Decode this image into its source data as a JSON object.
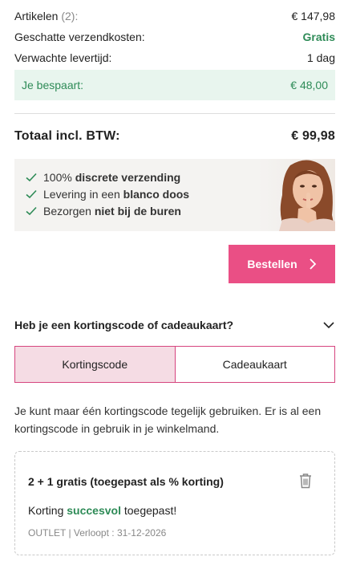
{
  "summary": {
    "items_label": "Artikelen",
    "items_count": "(2):",
    "items_value": "€ 147,98",
    "shipping_label": "Geschatte verzendkosten:",
    "shipping_value": "Gratis",
    "delivery_label": "Verwachte levertijd:",
    "delivery_value": "1 dag",
    "savings_label": "Je bespaart:",
    "savings_value": "€ 48,00",
    "total_label": "Totaal incl. BTW:",
    "total_value": "€ 99,98"
  },
  "promo": {
    "lines": [
      {
        "pre": "100%",
        "bold": "discrete verzending",
        "post": ""
      },
      {
        "pre": "Levering in een",
        "bold": "blanco doos",
        "post": ""
      },
      {
        "pre": "Bezorgen",
        "bold": "niet bij de buren",
        "post": ""
      }
    ]
  },
  "order_button": {
    "label": "Bestellen"
  },
  "coupon": {
    "heading": "Heb je een kortingscode of cadeaukaart?",
    "tabs": [
      "Kortingscode",
      "Cadeaukaart"
    ],
    "info": "Je kunt maar één kortingscode tegelijk gebruiken. Er is al een kortingscode in gebruik in je winkelmand.",
    "applied": {
      "title": "2 + 1 gratis (toegepast als % korting)",
      "status_pre": "Korting",
      "status_word": "succesvol",
      "status_post": "toegepast!",
      "meta": "OUTLET | Verloopt : 31-12-2026"
    }
  },
  "colors": {
    "accent": "#ea4f85",
    "success": "#2e8b57",
    "savings_bg": "#e8f5ee",
    "tab_active_bg": "#f5dce4"
  }
}
